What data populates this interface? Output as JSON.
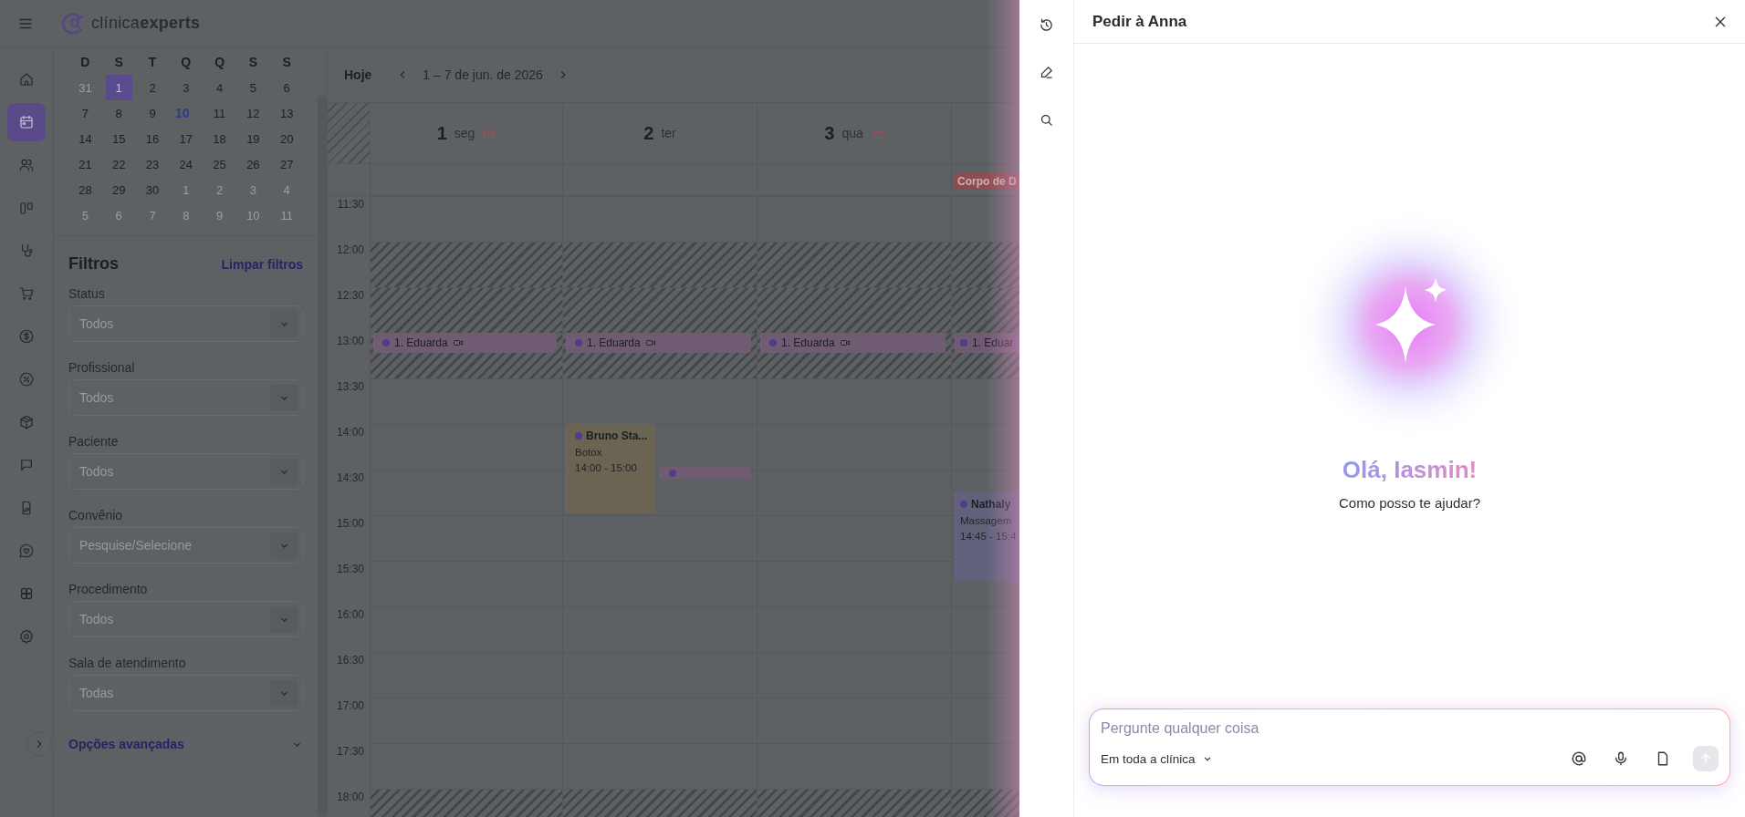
{
  "topbar": {
    "brand": "clínica**experts**"
  },
  "nav": [
    {
      "kind": "home",
      "selected": false
    },
    {
      "kind": "calendar",
      "selected": true
    },
    {
      "kind": "users",
      "selected": false
    },
    {
      "kind": "board",
      "selected": false
    },
    {
      "kind": "stethoscope",
      "selected": false
    },
    {
      "kind": "cart",
      "selected": false
    },
    {
      "kind": "dollar",
      "selected": false
    },
    {
      "kind": "percent",
      "selected": false
    },
    {
      "kind": "package",
      "selected": false
    },
    {
      "kind": "chat",
      "selected": false
    },
    {
      "kind": "document",
      "selected": false
    },
    {
      "kind": "heart-chat",
      "selected": false
    },
    {
      "kind": "clover",
      "selected": false
    },
    {
      "kind": "settings",
      "selected": false
    }
  ],
  "mini_calendar": {
    "weekdays": [
      "D",
      "S",
      "T",
      "Q",
      "Q",
      "S",
      "S"
    ],
    "weeks": [
      [
        {
          "day": "31",
          "outside": true,
          "selected": false,
          "today": false
        },
        {
          "day": "1",
          "outside": false,
          "selected": true,
          "today": false
        },
        {
          "day": "2",
          "outside": false,
          "selected": false,
          "today": false
        },
        {
          "day": "3",
          "outside": false,
          "selected": false,
          "today": false
        },
        {
          "day": "4",
          "outside": false,
          "selected": false,
          "today": false
        },
        {
          "day": "5",
          "outside": false,
          "selected": false,
          "today": false
        },
        {
          "day": "6",
          "outside": false,
          "selected": false,
          "today": false
        }
      ],
      [
        {
          "day": "7",
          "outside": false,
          "selected": false,
          "today": false
        },
        {
          "day": "8",
          "outside": false,
          "selected": false,
          "today": false
        },
        {
          "day": "9",
          "outside": false,
          "selected": false,
          "today": false
        },
        {
          "day": "10",
          "outside": false,
          "selected": false,
          "today": true
        },
        {
          "day": "11",
          "outside": false,
          "selected": false,
          "today": false
        },
        {
          "day": "12",
          "outside": false,
          "selected": false,
          "today": false
        },
        {
          "day": "13",
          "outside": false,
          "selected": false,
          "today": false
        }
      ],
      [
        {
          "day": "14",
          "outside": false,
          "selected": false,
          "today": false
        },
        {
          "day": "15",
          "outside": false,
          "selected": false,
          "today": false
        },
        {
          "day": "16",
          "outside": false,
          "selected": false,
          "today": false
        },
        {
          "day": "17",
          "outside": false,
          "selected": false,
          "today": false
        },
        {
          "day": "18",
          "outside": false,
          "selected": false,
          "today": false
        },
        {
          "day": "19",
          "outside": false,
          "selected": false,
          "today": false
        },
        {
          "day": "20",
          "outside": false,
          "selected": false,
          "today": false
        }
      ],
      [
        {
          "day": "21",
          "outside": false,
          "selected": false,
          "today": false
        },
        {
          "day": "22",
          "outside": false,
          "selected": false,
          "today": false
        },
        {
          "day": "23",
          "outside": false,
          "selected": false,
          "today": false
        },
        {
          "day": "24",
          "outside": false,
          "selected": false,
          "today": false
        },
        {
          "day": "25",
          "outside": false,
          "selected": false,
          "today": false
        },
        {
          "day": "26",
          "outside": false,
          "selected": false,
          "today": false
        },
        {
          "day": "27",
          "outside": false,
          "selected": false,
          "today": false
        }
      ],
      [
        {
          "day": "28",
          "outside": false,
          "selected": false,
          "today": false
        },
        {
          "day": "29",
          "outside": false,
          "selected": false,
          "today": false
        },
        {
          "day": "30",
          "outside": false,
          "selected": false,
          "today": false
        },
        {
          "day": "1",
          "outside": true,
          "selected": false,
          "today": false
        },
        {
          "day": "2",
          "outside": true,
          "selected": false,
          "today": false
        },
        {
          "day": "3",
          "outside": true,
          "selected": false,
          "today": false
        },
        {
          "day": "4",
          "outside": true,
          "selected": false,
          "today": false
        }
      ],
      [
        {
          "day": "5",
          "outside": true,
          "selected": false,
          "today": false
        },
        {
          "day": "6",
          "outside": true,
          "selected": false,
          "today": false
        },
        {
          "day": "7",
          "outside": true,
          "selected": false,
          "today": false
        },
        {
          "day": "8",
          "outside": true,
          "selected": false,
          "today": false
        },
        {
          "day": "9",
          "outside": true,
          "selected": false,
          "today": false
        },
        {
          "day": "10",
          "outside": true,
          "selected": false,
          "today": false
        },
        {
          "day": "11",
          "outside": true,
          "selected": false,
          "today": false
        }
      ]
    ]
  },
  "filters": {
    "title": "Filtros",
    "clear": "Limpar filtros",
    "fields": [
      {
        "label": "Status",
        "placeholder": "Todos"
      },
      {
        "label": "Profissional",
        "placeholder": "Todos"
      },
      {
        "label": "Paciente",
        "placeholder": "Todos"
      },
      {
        "label": "Convênio",
        "placeholder": "Pesquise/Selecione"
      },
      {
        "label": "Procedimento",
        "placeholder": "Todos"
      },
      {
        "label": "Sala de atendimento",
        "placeholder": "Todas"
      }
    ],
    "advanced": "Opções avançadas"
  },
  "calendar": {
    "today_button": "Hoje",
    "range": "1 – 7 de jun. de 2026",
    "times": [
      {
        "label": "11:30",
        "hatched": false
      },
      {
        "label": "12:00",
        "hatched": true
      },
      {
        "label": "12:30",
        "hatched": true
      },
      {
        "label": "13:00",
        "hatched": true
      },
      {
        "label": "13:30",
        "hatched": false
      },
      {
        "label": "14:00",
        "hatched": false
      },
      {
        "label": "14:30",
        "hatched": false
      },
      {
        "label": "15:00",
        "hatched": false
      },
      {
        "label": "15:30",
        "hatched": false
      },
      {
        "label": "16:00",
        "hatched": false
      },
      {
        "label": "16:30",
        "hatched": false
      },
      {
        "label": "17:00",
        "hatched": false
      },
      {
        "label": "17:30",
        "hatched": false
      },
      {
        "label": "18:00",
        "hatched": true
      }
    ],
    "days": [
      {
        "number": "1",
        "weekday": "seg",
        "birthday": true,
        "events": [
          {
            "kind": "bar",
            "name": "1. Eduarda",
            "video": true,
            "color": "#6f5b72"
          }
        ]
      },
      {
        "number": "2",
        "weekday": "ter",
        "birthday": false,
        "events": [
          {
            "kind": "bar",
            "name": "1. Eduarda",
            "video": true,
            "color": "#6f5b72"
          },
          {
            "kind": "card",
            "name": "Bruno Sta...",
            "detail": "Botox",
            "time": "14:00 - 15:00",
            "color": "#6c6452"
          },
          {
            "kind": "stub",
            "color": "#6f5b72"
          }
        ]
      },
      {
        "number": "3",
        "weekday": "qua",
        "birthday": true,
        "events": [
          {
            "kind": "bar",
            "name": "1. Eduarda",
            "video": true,
            "color": "#6f5b72"
          }
        ]
      },
      {
        "all_day": [
          {
            "label": "Corpo de D",
            "color": "#8e4c50"
          }
        ],
        "events": [
          {
            "kind": "bar",
            "name": "1. Eduar",
            "video": false,
            "color": "#6f5b72"
          },
          {
            "kind": "card",
            "name": "Nathaly",
            "detail": "Massagem",
            "time": "14:45 - 15:4",
            "color": "#62617c"
          }
        ]
      }
    ]
  },
  "assistant": {
    "rail": [
      {
        "kind": "history"
      },
      {
        "kind": "new-chat"
      },
      {
        "kind": "search"
      }
    ],
    "title": "Pedir à Anna",
    "greeting": "Olá, Iasmin!",
    "subtitle": "Como posso te ajudar?",
    "input": {
      "placeholder": "Pergunte qualquer coisa",
      "scope": "Em toda a clínica",
      "send_disabled": true
    },
    "tools": [
      {
        "kind": "mention"
      },
      {
        "kind": "mic"
      },
      {
        "kind": "file"
      }
    ]
  }
}
